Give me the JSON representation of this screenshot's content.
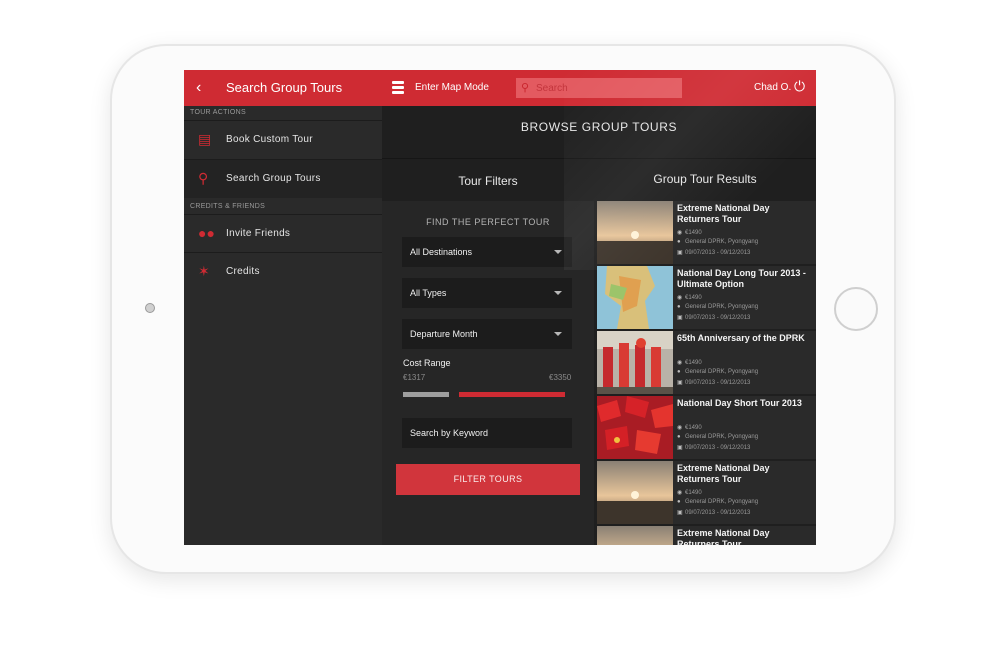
{
  "topbar": {
    "back_icon": "chevron-left-icon",
    "title": "Search Group Tours",
    "map_mode_label": "Enter Map Mode",
    "search_placeholder": "Search",
    "user_name": "Chad O.",
    "power_icon": "power-icon"
  },
  "sidebar": {
    "section_tour_actions": "TOUR ACTIONS",
    "section_credits_friends": "CREDITS & FRIENDS",
    "items": [
      {
        "label": "Book Custom Tour",
        "icon": "book-icon"
      },
      {
        "label": "Search Group Tours",
        "icon": "search-icon"
      },
      {
        "label": "Invite Friends",
        "icon": "people-icon"
      },
      {
        "label": "Credits",
        "icon": "star-icon"
      }
    ]
  },
  "main": {
    "header": "BROWSE GROUP TOURS",
    "filters_title": "Tour Filters",
    "results_title": "Group Tour Results"
  },
  "filters": {
    "find_label": "FIND THE PERFECT TOUR",
    "destinations": "All Destinations",
    "types": "All Types",
    "departure": "Departure Month",
    "cost_label": "Cost Range",
    "cost_min": "€1317",
    "cost_max": "€3350",
    "keyword_placeholder": "Search by Keyword",
    "filter_button": "FILTER TOURS"
  },
  "results": [
    {
      "title": "Extreme National Day Returners Tour",
      "price": "€1490",
      "location": "General DPRK, Pyongyang",
      "dates": "09/07/2013 - 09/12/2013"
    },
    {
      "title": "National Day Long Tour 2013 - Ultimate Option",
      "price": "€1490",
      "location": "General DPRK, Pyongyang",
      "dates": "09/07/2013 - 09/12/2013"
    },
    {
      "title": "65th Anniversary of the DPRK",
      "price": "€1490",
      "location": "General DPRK, Pyongyang",
      "dates": "09/07/2013 - 09/12/2013"
    },
    {
      "title": "National Day Short Tour 2013",
      "price": "€1490",
      "location": "General DPRK, Pyongyang",
      "dates": "09/07/2013 - 09/12/2013"
    },
    {
      "title": "Extreme National Day Returners Tour",
      "price": "€1490",
      "location": "General DPRK, Pyongyang",
      "dates": "09/07/2013 - 09/12/2013"
    },
    {
      "title": "Extreme National Day Returners Tour",
      "price": "",
      "location": "",
      "dates": ""
    }
  ],
  "colors": {
    "accent": "#cf2b33",
    "background": "#222222",
    "panel": "#2a2a2a"
  }
}
